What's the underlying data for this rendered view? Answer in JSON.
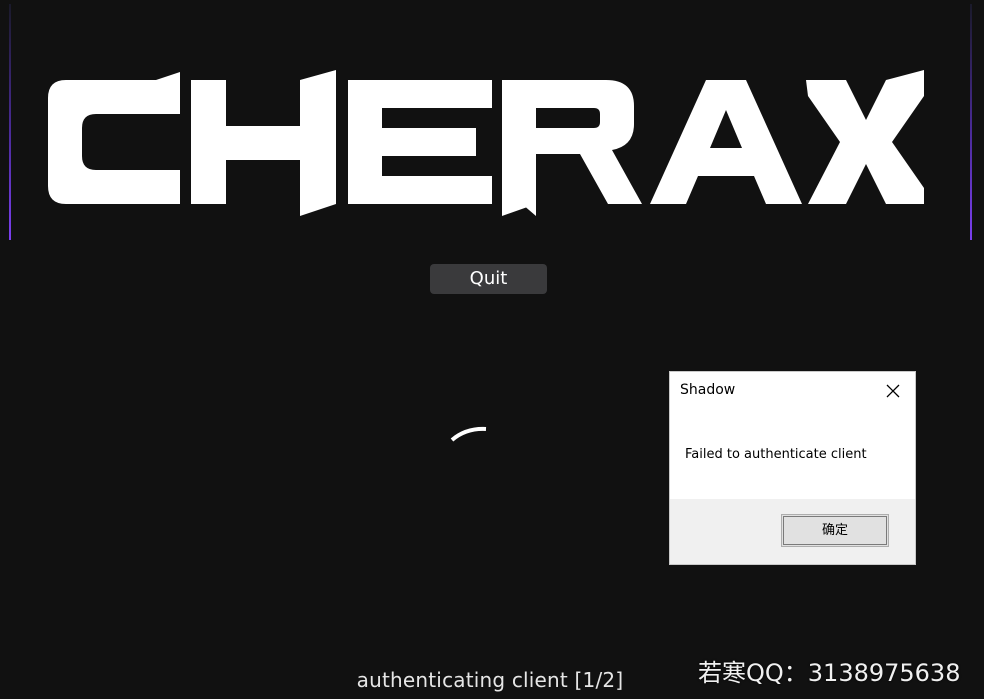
{
  "app": {
    "logo_text": "CHERAX",
    "quit_label": "Quit",
    "status_text": "authenticating client [1/2]",
    "accent_color": "#7b3ff0",
    "background_color": "#111111"
  },
  "dialog": {
    "title": "Shadow",
    "message": "Failed to authenticate client",
    "ok_label": "确定",
    "close_icon": "close-icon"
  },
  "watermark": {
    "text": "若寒QQ：3138975638"
  },
  "icons": {
    "spinner": "loading-spinner-icon"
  }
}
